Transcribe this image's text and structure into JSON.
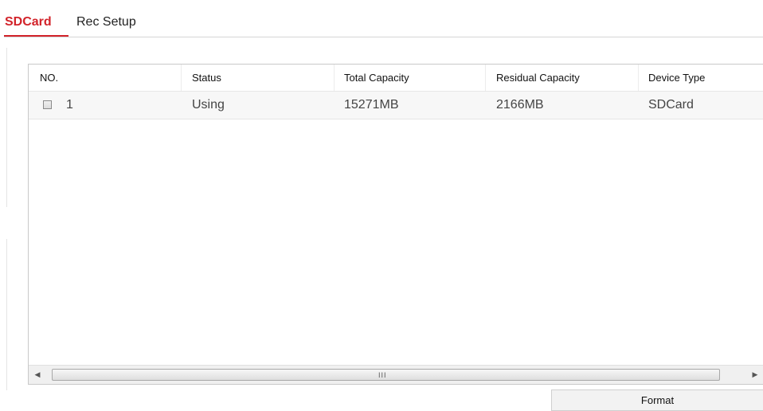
{
  "tabs": [
    {
      "label": "SDCard",
      "active": true
    },
    {
      "label": "Rec Setup",
      "active": false
    }
  ],
  "table": {
    "columns": [
      "NO.",
      "Status",
      "Total Capacity",
      "Residual Capacity",
      "Device Type"
    ],
    "rows": [
      {
        "checked": false,
        "no": "1",
        "status": "Using",
        "total_capacity": "15271MB",
        "residual_capacity": "2166MB",
        "device_type": "SDCard"
      }
    ]
  },
  "scrollbar": {
    "left_arrow": "◀",
    "right_arrow": "▶",
    "grip": "III"
  },
  "actions": {
    "format_label": "Format"
  },
  "colors": {
    "accent": "#d2232a",
    "row_bg": "#f7f7f7",
    "border": "#c9c9c9"
  }
}
